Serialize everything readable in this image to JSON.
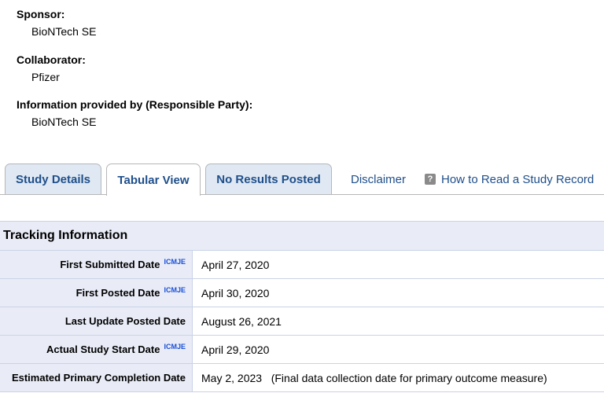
{
  "party": {
    "sponsor_label": "Sponsor:",
    "sponsor_value": "BioNTech SE",
    "collaborator_label": "Collaborator:",
    "collaborator_value": "Pfizer",
    "info_label": "Information provided by (Responsible Party):",
    "info_value": "BioNTech SE"
  },
  "tabs": {
    "study_details": "Study Details",
    "tabular_view": "Tabular View",
    "no_results": "No Results Posted",
    "disclaimer": "Disclaimer",
    "help_icon": "?",
    "how_to_read": "How to Read a Study Record"
  },
  "tracking": {
    "header": "Tracking Information",
    "icmje": "ICMJE",
    "rows": [
      {
        "label": "First Submitted Date",
        "value": "April 27, 2020"
      },
      {
        "label": "First Posted Date",
        "value": "April 30, 2020"
      },
      {
        "label": "Last Update Posted Date",
        "value": "August 26, 2021"
      },
      {
        "label": "Actual Study Start Date",
        "value": "April 29, 2020"
      },
      {
        "label": "Estimated Primary Completion Date",
        "value": "May 2, 2023   (Final data collection date for primary outcome measure)"
      }
    ]
  },
  "colors": {
    "link": "#1f4f8a",
    "tab_inactive_bg": "#dfe8f3",
    "label_bg": "#e9ecf7",
    "icmje": "#1a4fd6"
  }
}
